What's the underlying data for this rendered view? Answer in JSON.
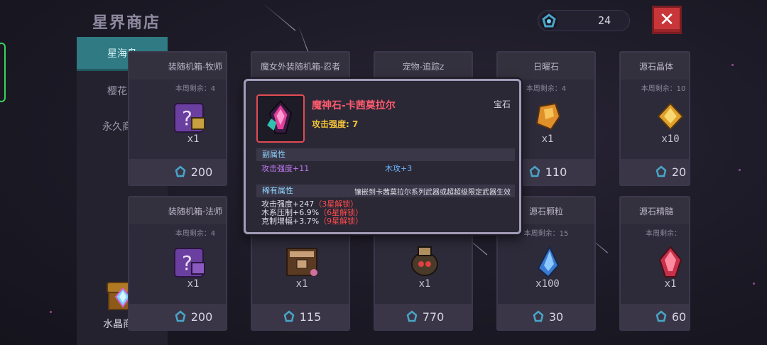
{
  "shop_title": "星界商店",
  "currency": {
    "icon": "blue-gem-icon",
    "value": "24"
  },
  "close_label": "✕",
  "tabs": [
    {
      "label": "星海岛",
      "active": true
    },
    {
      "label": "樱花岛",
      "active": false
    },
    {
      "label": "永久商店",
      "active": false
    }
  ],
  "crystal_shop": {
    "icon": "crystal-chest-icon",
    "label": "水晶商店"
  },
  "price_icon": "blue-gem-icon",
  "cards": [
    {
      "title": "装随机箱-牧师",
      "remaining": "本周剩余：4",
      "icon": "mystery-box-icon",
      "qty": "x1",
      "price": "200"
    },
    {
      "title": "魔女外装随机箱-忍者",
      "remaining": "",
      "icon": "",
      "qty": "",
      "price": ""
    },
    {
      "title": "宠物-追踪z",
      "remaining": "",
      "icon": "",
      "qty": "",
      "price": ""
    },
    {
      "title": "日曜石",
      "remaining": "本周剩余：4",
      "icon": "orange-stone-icon",
      "qty": "x1",
      "price": "110"
    },
    {
      "title": "源石晶体",
      "remaining": "本周剩余：10",
      "icon": "gold-crystal-icon",
      "qty": "x10",
      "price": "20"
    },
    {
      "title": "装随机箱-法师",
      "remaining": "本周剩余：4",
      "icon": "mystery-box-icon",
      "qty": "x1",
      "price": "200"
    },
    {
      "title": "",
      "remaining": "",
      "icon": "treasure-chest-icon",
      "qty": "x1",
      "price": "115"
    },
    {
      "title": "",
      "remaining": "",
      "icon": "pet-egg-icon",
      "qty": "x1",
      "price": "770"
    },
    {
      "title": "源石颗粒",
      "remaining": "本周剩余：15",
      "icon": "blue-shard-icon",
      "qty": "x100",
      "price": "30"
    },
    {
      "title": "源石精髓",
      "remaining": "本周剩余：",
      "icon": "red-crystal-icon",
      "qty": "x1",
      "price": "60"
    }
  ],
  "tooltip": {
    "icon": "demon-gem-icon",
    "name": "魔神石-卡茜莫拉尔",
    "type": "宝石",
    "base_stat": "攻击强度: 7",
    "sub_header": "副属性",
    "sub_attrs": [
      "攻击强度+11",
      "木攻+3"
    ],
    "rare_header": "稀有属性",
    "rare_note": "镶嵌到卡茜莫拉尔系列武器或超超级限定武器生效",
    "rare_attrs": [
      {
        "text": "攻击强度+247",
        "unlock": "（3星解锁）"
      },
      {
        "text": "木系压制+6.9%",
        "unlock": "（6星解锁）"
      },
      {
        "text": "克制增幅+3.7%",
        "unlock": "（9星解锁）"
      }
    ]
  }
}
